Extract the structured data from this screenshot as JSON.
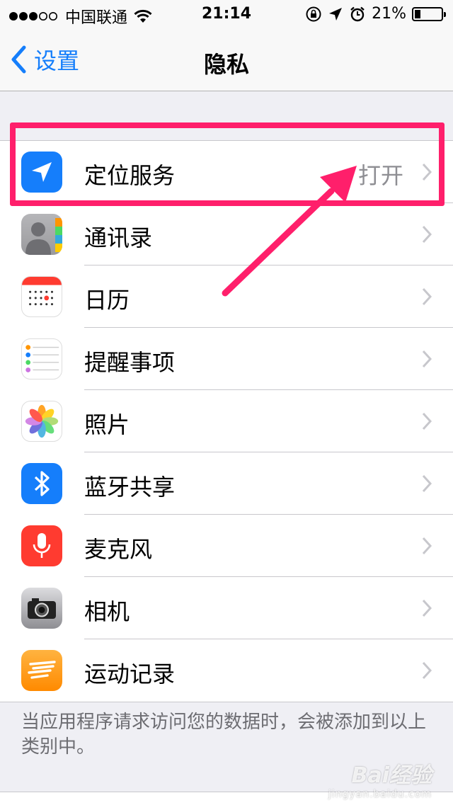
{
  "status_bar": {
    "carrier": "中国联通",
    "time": "21:14",
    "battery": "21%"
  },
  "nav": {
    "back_label": "设置",
    "title": "隐私"
  },
  "items": [
    {
      "label": "定位服务",
      "value": "打开",
      "icon": "location-arrow-icon",
      "color": "#157efb"
    },
    {
      "label": "通讯录",
      "value": "",
      "icon": "contacts-icon",
      "color": "#a8a8ab"
    },
    {
      "label": "日历",
      "value": "",
      "icon": "calendar-icon",
      "color": "#ffffff"
    },
    {
      "label": "提醒事项",
      "value": "",
      "icon": "reminders-icon",
      "color": "#ffffff"
    },
    {
      "label": "照片",
      "value": "",
      "icon": "photos-icon",
      "color": "#ffffff"
    },
    {
      "label": "蓝牙共享",
      "value": "",
      "icon": "bluetooth-icon",
      "color": "#157efb"
    },
    {
      "label": "麦克风",
      "value": "",
      "icon": "microphone-icon",
      "color": "#ff3b30"
    },
    {
      "label": "相机",
      "value": "",
      "icon": "camera-icon",
      "color": "#8e8e93"
    },
    {
      "label": "运动记录",
      "value": "",
      "icon": "motion-icon",
      "color": "#ff9500"
    }
  ],
  "footer_note": "当应用程序请求访问您的数据时，会被添加到以上类别中。",
  "watermark": {
    "main": "Bai经验",
    "sub": "jingyan.baidu.com"
  },
  "colors": {
    "accent": "#157efb",
    "annotation": "#ff1f6b",
    "background": "#efeff4"
  }
}
